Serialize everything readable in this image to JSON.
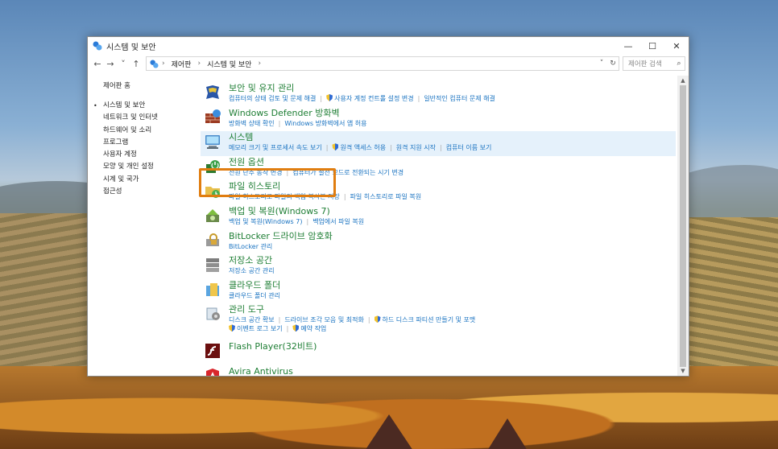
{
  "window": {
    "title": "시스템 및 보안",
    "controls": {
      "minimize": "—",
      "maximize": "☐",
      "close": "✕"
    }
  },
  "address": {
    "back": "←",
    "forward": "→",
    "recent": "˅",
    "up": "↑",
    "crumbs": [
      "제어판",
      "시스템 및 보안"
    ],
    "sep": "›",
    "dropdown": "˅",
    "refresh": "↻",
    "search_placeholder": "제어판 검색",
    "search_icon": "⌕"
  },
  "leftnav": {
    "home": "제어판 홈",
    "bullet": "•",
    "items": [
      "시스템 및 보안",
      "네트워크 및 인터넷",
      "하드웨어 및 소리",
      "프로그램",
      "사용자 계정",
      "모양 및 개인 설정",
      "시계 및 국가",
      "접근성"
    ]
  },
  "categories": [
    {
      "title": "보안 및 유지 관리",
      "icon": "flag-icon",
      "links": [
        {
          "text": "컴퓨터의 상태 검토 및 문제 해결",
          "shield": false
        },
        {
          "text": "사용자 계정 컨트롤 설정 변경",
          "shield": true
        },
        {
          "text": "일반적인 컴퓨터 문제 해결",
          "shield": false
        }
      ]
    },
    {
      "title": "Windows Defender 방화벽",
      "icon": "firewall-icon",
      "links": [
        {
          "text": "방화벽 상태 확인",
          "shield": false
        },
        {
          "text": "Windows 방화벽에서 앱 허용",
          "shield": false
        }
      ]
    },
    {
      "title": "시스템",
      "icon": "computer-icon",
      "highlight": true,
      "links": [
        {
          "text": "메모리 크기 및 프로세서 속도 보기",
          "shield": false
        },
        {
          "text": "원격 액세스 허용",
          "shield": true
        },
        {
          "text": "원격 지원 시작",
          "shield": false
        },
        {
          "text": "컴퓨터 이름 보기",
          "shield": false
        }
      ]
    },
    {
      "title": "전원 옵션",
      "icon": "power-icon",
      "links": [
        {
          "text": "전원 단추 동작 변경",
          "shield": false
        },
        {
          "text": "컴퓨터가 절전 모드로 전환되는 시기 변경",
          "shield": false
        }
      ]
    },
    {
      "title": "파일 히스토리",
      "icon": "file-history-icon",
      "links": [
        {
          "text": "파일 히스토리로 파일의 백업 복사본 저장",
          "shield": false
        },
        {
          "text": "파일 히스토리로 파일 복원",
          "shield": false
        }
      ]
    },
    {
      "title": "백업 및 복원(Windows 7)",
      "icon": "backup-icon",
      "links": [
        {
          "text": "백업 및 복원(Windows 7)",
          "shield": false
        },
        {
          "text": "백업에서 파일 복원",
          "shield": false
        }
      ]
    },
    {
      "title": "BitLocker 드라이브 암호화",
      "icon": "bitlocker-icon",
      "links": [
        {
          "text": "BitLocker 관리",
          "shield": false
        }
      ]
    },
    {
      "title": "저장소 공간",
      "icon": "storage-icon",
      "links": [
        {
          "text": "저장소 공간 관리",
          "shield": false
        }
      ]
    },
    {
      "title": "클라우드 폴더",
      "icon": "cloud-folder-icon",
      "links": [
        {
          "text": "클라우드 폴더 관리",
          "shield": false
        }
      ]
    },
    {
      "title": "관리 도구",
      "icon": "admin-tools-icon",
      "tall": true,
      "links": [
        {
          "text": "디스크 공간 확보",
          "shield": false
        },
        {
          "text": "드라이브 조각 모음 및 최적화",
          "shield": false
        },
        {
          "text": "하드 디스크 파티션 만들기 및 포맷",
          "shield": true
        }
      ],
      "links2": [
        {
          "text": "이벤트 로그 보기",
          "shield": true
        },
        {
          "text": "예약 작업",
          "shield": true
        }
      ]
    },
    {
      "title": "Flash Player(32비트)",
      "icon": "flash-icon",
      "links": []
    },
    {
      "title": "Avira Antivirus",
      "icon": "avira-icon",
      "links": []
    }
  ],
  "scrollbar": {
    "up": "▲",
    "down": "▼"
  }
}
